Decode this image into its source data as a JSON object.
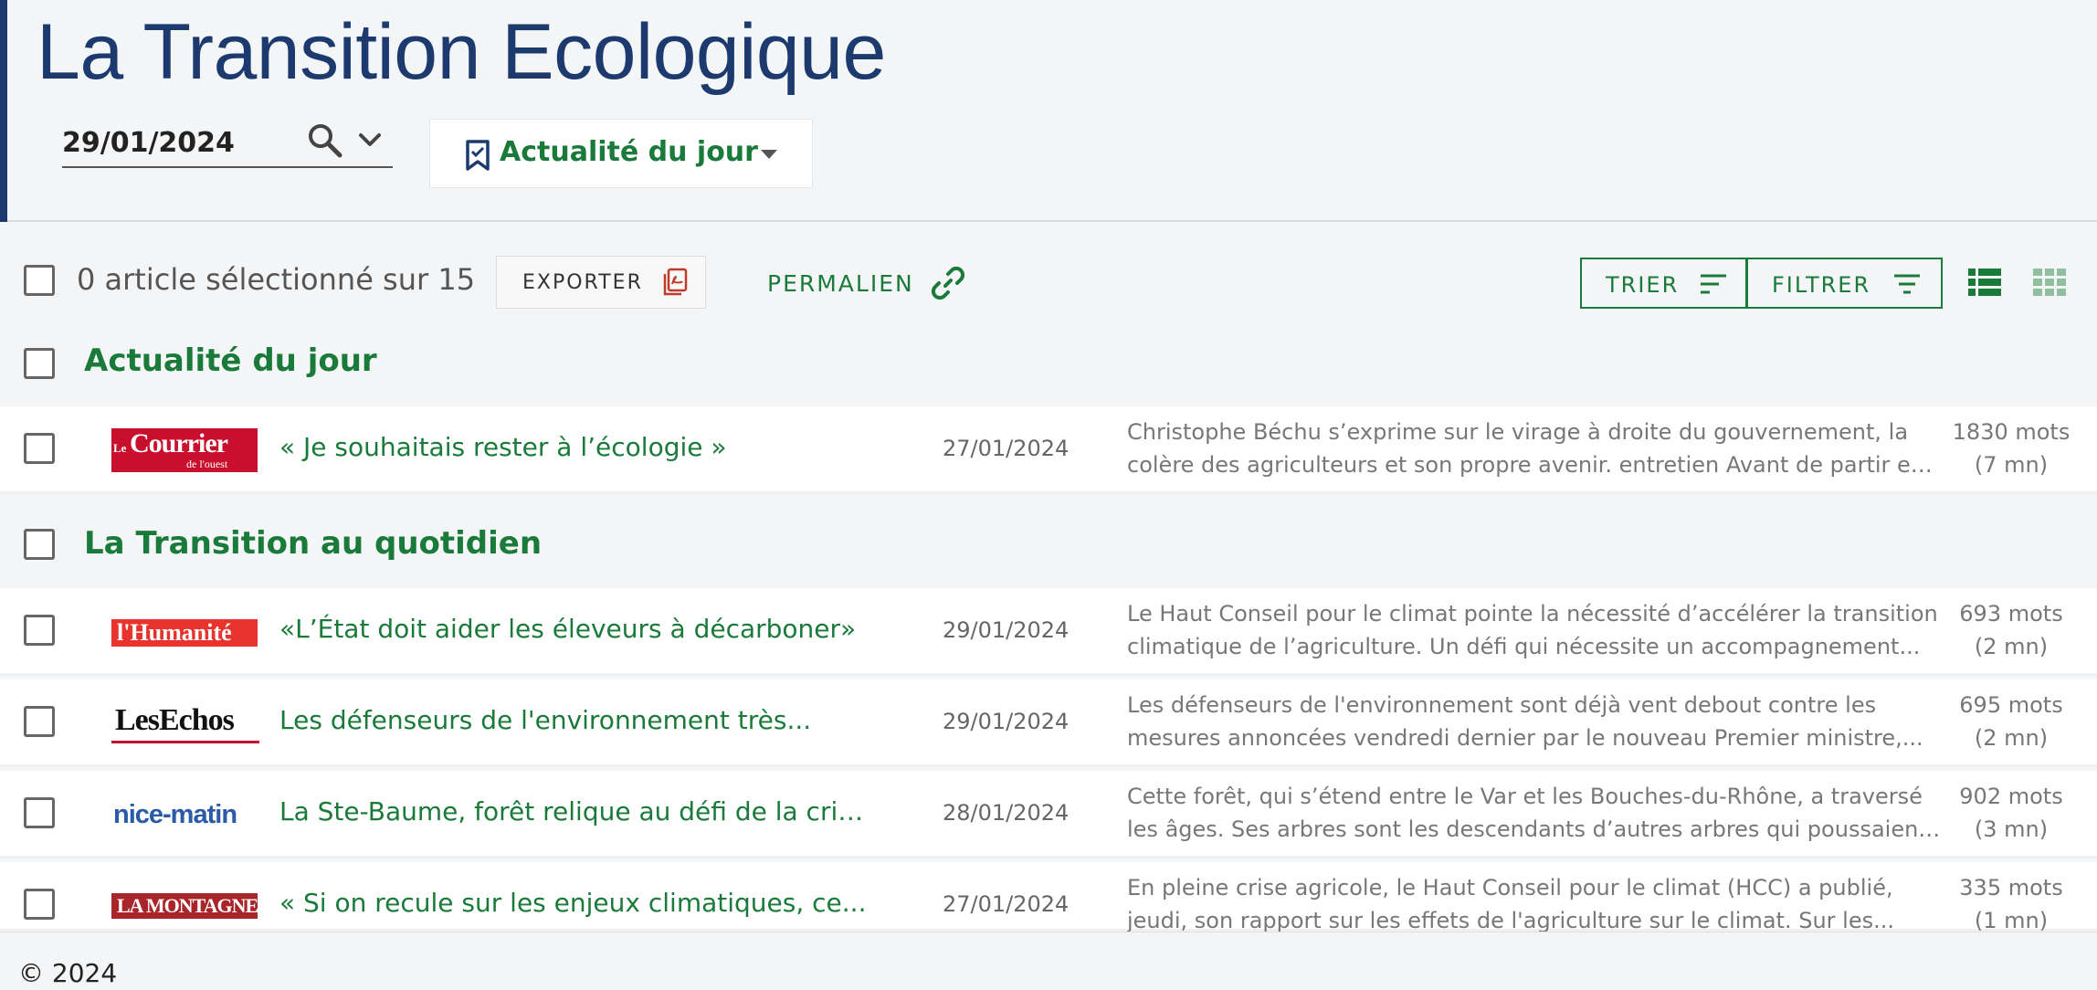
{
  "header": {
    "title": "La Transition Ecologique",
    "date_value": "29/01/2024",
    "topic_select": "Actualité du jour"
  },
  "toolbar": {
    "selection_count": "0 article sélectionné sur 15",
    "export_label": "EXPORTER",
    "permalink_label": "PERMALIEN",
    "sort_label": "TRIER",
    "filter_label": "FILTRER"
  },
  "colors": {
    "brand_blue": "#1c3a6e",
    "accent_green": "#1a7a3a"
  },
  "sections": [
    {
      "title": "Actualité du jour",
      "articles": [
        {
          "source": "Le Courrier de l'ouest",
          "logo_text": [
            "Le",
            "Courrier",
            "de l'ouest"
          ],
          "headline": "« Je souhaitais rester à l’écologie »",
          "date": "27/01/2024",
          "summary_line1": "Christophe Béchu s’exprime sur le virage à droite du gouvernement, la",
          "summary_line2": "colère des agriculteurs et son propre avenir. entretien Avant de partir en...",
          "words": "1830 mots",
          "duration": "(7 mn)"
        }
      ]
    },
    {
      "title": "La Transition au quotidien",
      "articles": [
        {
          "source": "l'Humanité",
          "logo_text": "l'Humanité",
          "headline": "«L’État doit aider les éleveurs à décarboner»",
          "date": "29/01/2024",
          "summary_line1": "Le Haut Conseil pour le climat pointe la nécessité d’accélérer la transition",
          "summary_line2": "climatique de l’agriculture. Un défi qui nécessite un accompagnement...",
          "words": "693 mots",
          "duration": "(2 mn)"
        },
        {
          "source": "Les Echos",
          "logo_text": "LesEchos",
          "headline": "Les défenseurs de l'environnement très...",
          "date": "29/01/2024",
          "summary_line1": "Les défenseurs de l'environnement sont déjà vent debout contre les",
          "summary_line2": "mesures annoncées vendredi dernier par le nouveau Premier ministre,...",
          "words": "695 mots",
          "duration": "(2 mn)"
        },
        {
          "source": "nice-matin",
          "logo_text": "nice-matin",
          "headline": "La Ste-Baume, forêt relique au défi de la cris...",
          "date": "28/01/2024",
          "summary_line1": "Cette forêt, qui s’étend entre le Var et les Bouches-du-Rhône, a traversé",
          "summary_line2": "les âges. Ses arbres sont les descendants d’autres arbres qui poussaient...",
          "words": "902 mots",
          "duration": "(3 mn)"
        },
        {
          "source": "La Montagne",
          "logo_text": "LA MONTAGNE",
          "headline": "« Si on recule sur les enjeux climatiques, ce...",
          "date": "27/01/2024",
          "summary_line1": "En pleine crise agricole, le Haut Conseil pour le climat (HCC) a publié,",
          "summary_line2": "jeudi, son rapport sur les effets de l'agriculture sur le climat. Sur les...",
          "words": "335 mots",
          "duration": "(1 mn)"
        }
      ]
    }
  ],
  "footer": {
    "copyright": "© 2024"
  }
}
